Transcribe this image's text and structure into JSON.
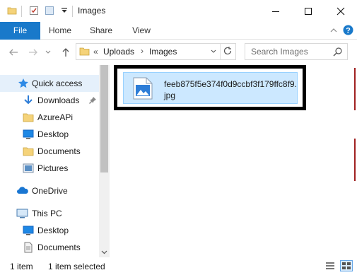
{
  "titlebar": {
    "title": "Images",
    "qa_icons": [
      "folder-icon",
      "properties-icon",
      "new-folder-icon",
      "dropdown-arrow-icon"
    ]
  },
  "ribbon": {
    "tabs": [
      {
        "label": "File"
      },
      {
        "label": "Home"
      },
      {
        "label": "Share"
      },
      {
        "label": "View"
      }
    ]
  },
  "address": {
    "overflow": "«",
    "crumbs": [
      "Uploads",
      "Images"
    ],
    "search_placeholder": "Search Images"
  },
  "nav": {
    "items": [
      {
        "label": "Quick access",
        "icon": "star-icon"
      },
      {
        "label": "Downloads",
        "icon": "download-arrow-icon",
        "pinned": true
      },
      {
        "label": "AzureAPi",
        "icon": "folder-icon"
      },
      {
        "label": "Desktop",
        "icon": "desktop-icon"
      },
      {
        "label": "Documents",
        "icon": "folder-icon"
      },
      {
        "label": "Pictures",
        "icon": "pictures-icon"
      },
      {
        "label": "OneDrive",
        "icon": "cloud-icon"
      },
      {
        "label": "This PC",
        "icon": "computer-icon"
      },
      {
        "label": "Desktop",
        "icon": "desktop-icon"
      },
      {
        "label": "Documents",
        "icon": "documents-icon"
      }
    ]
  },
  "content": {
    "file": {
      "name": "feeb875f5e374f0d9ccbf3f179ffc8f9.jpg",
      "icon": "image-file-icon",
      "selected": true
    }
  },
  "status": {
    "count": "1 item",
    "selection": "1 item selected"
  },
  "colors": {
    "accent": "#1979ca",
    "selection": "#cce8ff",
    "hover": "#e5f0fb"
  }
}
